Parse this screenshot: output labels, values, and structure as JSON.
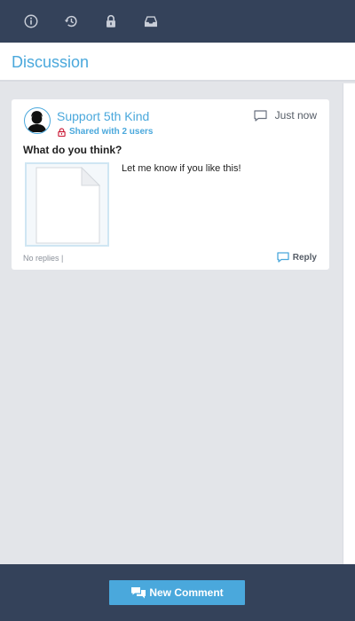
{
  "toolbar": {
    "icons": [
      "info-icon",
      "history-icon",
      "lock-icon",
      "inbox-icon"
    ]
  },
  "header": {
    "title": "Discussion"
  },
  "post": {
    "author": "Support 5th Kind",
    "shared_text": "Shared with 2 users",
    "timestamp": "Just now",
    "question": "What do you think?",
    "message": "Let me know if you like this!",
    "replies_text": "No replies |",
    "reply_label": "Reply"
  },
  "footer": {
    "new_comment_label": "New Comment"
  },
  "colors": {
    "accent": "#4aa8dc",
    "toolbar_bg": "#34425a",
    "content_bg": "#e3e5e9",
    "lock_red": "#c8102e"
  }
}
